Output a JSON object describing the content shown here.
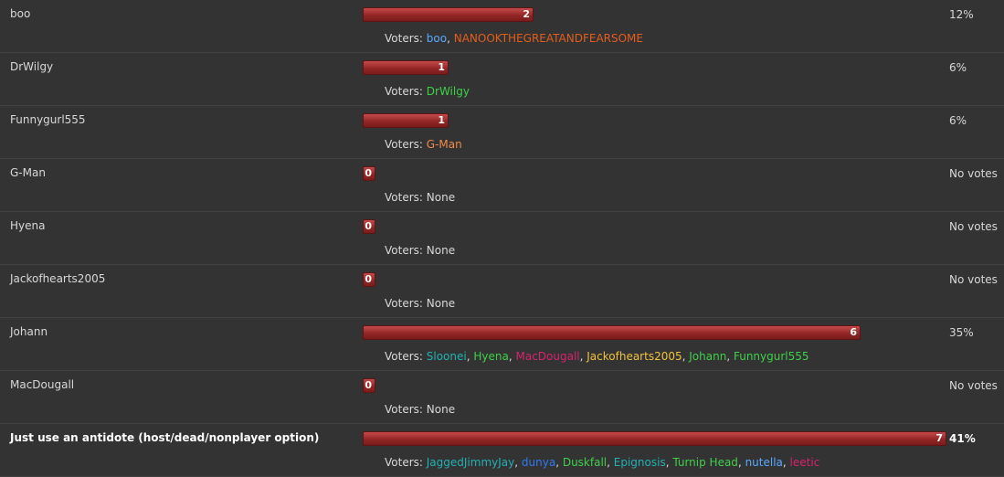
{
  "poll": {
    "voters_label": "Voters:",
    "options": [
      {
        "label": "boo",
        "count": "2",
        "fraction": 0.12,
        "percent_text": "12%",
        "bold": false,
        "voters": [
          {
            "name": "boo",
            "color": "#5aa9ff"
          },
          {
            "name": "NANOOKTHEGREATANDFEARSOME",
            "color": "#e25e1c"
          }
        ],
        "none_text": ""
      },
      {
        "label": "DrWilgy",
        "count": "1",
        "fraction": 0.06,
        "percent_text": "6%",
        "bold": false,
        "voters": [
          {
            "name": "DrWilgy",
            "color": "#3fd04a"
          }
        ],
        "none_text": ""
      },
      {
        "label": "Funnygurl555",
        "count": "1",
        "fraction": 0.06,
        "percent_text": "6%",
        "bold": false,
        "voters": [
          {
            "name": "G-Man",
            "color": "#f08a4b"
          }
        ],
        "none_text": ""
      },
      {
        "label": "G-Man",
        "count": "0",
        "fraction": 0,
        "percent_text": "No votes",
        "bold": false,
        "voters": [],
        "none_text": "None"
      },
      {
        "label": "Hyena",
        "count": "0",
        "fraction": 0,
        "percent_text": "No votes",
        "bold": false,
        "voters": [],
        "none_text": "None"
      },
      {
        "label": "Jackofhearts2005",
        "count": "0",
        "fraction": 0,
        "percent_text": "No votes",
        "bold": false,
        "voters": [],
        "none_text": "None"
      },
      {
        "label": "Johann",
        "count": "6",
        "fraction": 0.35,
        "percent_text": "35%",
        "bold": false,
        "voters": [
          {
            "name": "Sloonei",
            "color": "#22b2b2"
          },
          {
            "name": "Hyena",
            "color": "#3fd04a"
          },
          {
            "name": "MacDougall",
            "color": "#d6246e"
          },
          {
            "name": "Jackofhearts2005",
            "color": "#f0c23b"
          },
          {
            "name": "Johann",
            "color": "#3fd04a"
          },
          {
            "name": "Funnygurl555",
            "color": "#3fd04a"
          }
        ],
        "none_text": ""
      },
      {
        "label": "MacDougall",
        "count": "0",
        "fraction": 0,
        "percent_text": "No votes",
        "bold": false,
        "voters": [],
        "none_text": "None"
      },
      {
        "label": "Just use an antidote (host/dead/nonplayer option)",
        "count": "7",
        "fraction": 0.41,
        "percent_text": "41%",
        "bold": true,
        "voters": [
          {
            "name": "JaggedJimmyJay",
            "color": "#22b2b2"
          },
          {
            "name": "dunya",
            "color": "#2f7bf0"
          },
          {
            "name": "Duskfall",
            "color": "#3fd04a"
          },
          {
            "name": "Epignosis",
            "color": "#22b2b2"
          },
          {
            "name": "Turnip Head",
            "color": "#3fd04a"
          },
          {
            "name": "nutella",
            "color": "#5aa9ff"
          },
          {
            "name": "leetic",
            "color": "#d6246e"
          }
        ],
        "none_text": ""
      }
    ]
  }
}
